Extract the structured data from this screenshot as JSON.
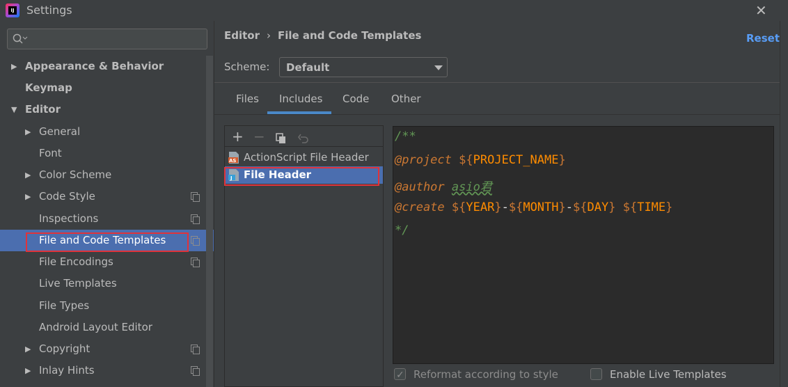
{
  "window": {
    "title": "Settings",
    "app_icon_text": "IJ"
  },
  "sidebar": {
    "search": {
      "placeholder": ""
    },
    "items": [
      {
        "label": "Appearance & Behavior",
        "level": 0,
        "arrow": "right"
      },
      {
        "label": "Keymap",
        "level": 0,
        "arrow": "none"
      },
      {
        "label": "Editor",
        "level": 0,
        "arrow": "down"
      },
      {
        "label": "General",
        "level": 1,
        "arrow": "right"
      },
      {
        "label": "Font",
        "level": 1,
        "arrow": "none"
      },
      {
        "label": "Color Scheme",
        "level": 1,
        "arrow": "right"
      },
      {
        "label": "Code Style",
        "level": 1,
        "arrow": "right",
        "copy_icon": true
      },
      {
        "label": "Inspections",
        "level": 1,
        "arrow": "none",
        "copy_icon": true
      },
      {
        "label": "File and Code Templates",
        "level": 1,
        "arrow": "none",
        "copy_icon": true,
        "selected": true
      },
      {
        "label": "File Encodings",
        "level": 1,
        "arrow": "none",
        "copy_icon": true
      },
      {
        "label": "Live Templates",
        "level": 1,
        "arrow": "none"
      },
      {
        "label": "File Types",
        "level": 1,
        "arrow": "none"
      },
      {
        "label": "Android Layout Editor",
        "level": 1,
        "arrow": "none"
      },
      {
        "label": "Copyright",
        "level": 1,
        "arrow": "right",
        "copy_icon": true
      },
      {
        "label": "Inlay Hints",
        "level": 1,
        "arrow": "right",
        "copy_icon": true
      }
    ]
  },
  "main": {
    "breadcrumb": {
      "parent": "Editor",
      "separator": "›",
      "current": "File and Code Templates"
    },
    "reset_label": "Reset",
    "scheme": {
      "label": "Scheme:",
      "value": "Default"
    },
    "tabs": [
      "Files",
      "Includes",
      "Code",
      "Other"
    ],
    "active_tab": "Includes",
    "toolbar": {
      "add": "+",
      "remove": "−",
      "copy": "copy-icon",
      "revert": "undo-icon"
    },
    "templates": [
      {
        "name": "ActionScript File Header",
        "icon": "actionscript-file-icon",
        "badge": "AS"
      },
      {
        "name": "File Header",
        "icon": "java-file-icon",
        "badge": "J",
        "selected": true
      }
    ],
    "editor": {
      "lines": [
        {
          "parts": [
            {
              "t": "/**",
              "c": "comment"
            }
          ]
        },
        {
          "parts": [
            {
              "t": "@project",
              "c": "tag"
            },
            {
              "t": " ",
              "c": "text"
            },
            {
              "t": "${",
              "c": "dollar"
            },
            {
              "t": "PROJECT_NAME",
              "c": "var"
            },
            {
              "t": "}",
              "c": "dollar"
            }
          ]
        },
        {
          "parts": [
            {
              "t": "@author",
              "c": "tag"
            },
            {
              "t": " ",
              "c": "plain"
            },
            {
              "t": "asio君",
              "c": "text"
            }
          ]
        },
        {
          "parts": [
            {
              "t": "@create",
              "c": "tag"
            },
            {
              "t": " ",
              "c": "plain"
            },
            {
              "t": "${",
              "c": "dollar"
            },
            {
              "t": "YEAR",
              "c": "var"
            },
            {
              "t": "}",
              "c": "dollar"
            },
            {
              "t": "-",
              "c": "plain"
            },
            {
              "t": "${",
              "c": "dollar"
            },
            {
              "t": "MONTH",
              "c": "var"
            },
            {
              "t": "}",
              "c": "dollar"
            },
            {
              "t": "-",
              "c": "plain"
            },
            {
              "t": "${",
              "c": "dollar"
            },
            {
              "t": "DAY",
              "c": "var"
            },
            {
              "t": "}",
              "c": "dollar"
            },
            {
              "t": " ",
              "c": "plain"
            },
            {
              "t": "${",
              "c": "dollar"
            },
            {
              "t": "TIME",
              "c": "var"
            },
            {
              "t": "}",
              "c": "dollar"
            }
          ]
        },
        {
          "parts": [
            {
              "t": "*/",
              "c": "comment"
            }
          ]
        }
      ]
    },
    "options": {
      "reformat": {
        "label": "Reformat according to style",
        "checked": true,
        "enabled": false
      },
      "live_templates": {
        "label": "Enable Live Templates",
        "checked": false,
        "enabled": true
      }
    }
  }
}
